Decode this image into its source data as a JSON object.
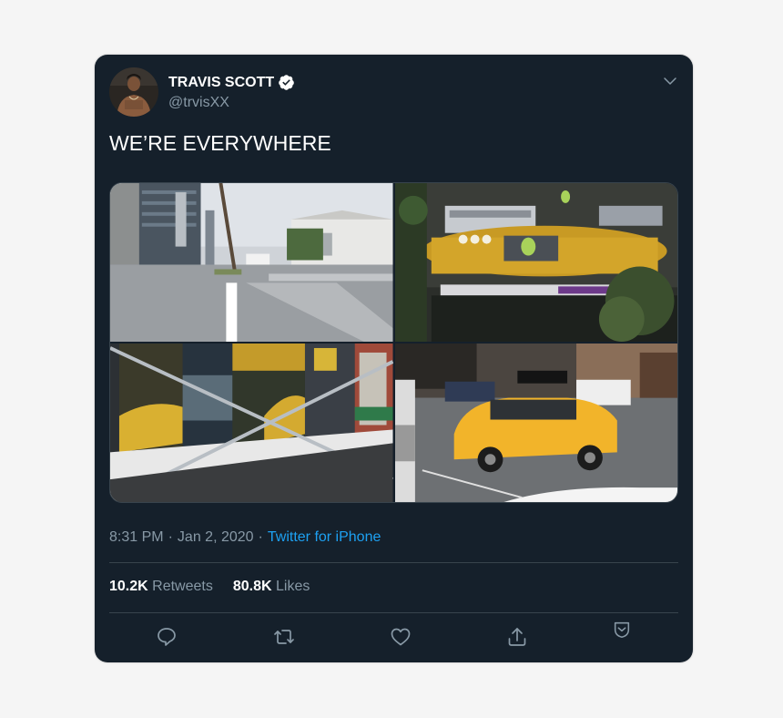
{
  "author": {
    "display_name": "TRAVIS SCOTT",
    "handle": "@trvisXX",
    "verified": true
  },
  "tweet": {
    "text": "WE’RE EVERYWHERE",
    "time": "8:31 PM",
    "date": "Jan 2, 2020",
    "separator": "·",
    "source": "Twitter for iPhone"
  },
  "media": {
    "photos": [
      {
        "subject": "street-intersection"
      },
      {
        "subject": "billboard-taxi-art"
      },
      {
        "subject": "construction-wall-posters"
      },
      {
        "subject": "yellow-taxi-street"
      }
    ]
  },
  "stats": {
    "retweets_count": "10.2K",
    "retweets_label": "Retweets",
    "likes_count": "80.8K",
    "likes_label": "Likes"
  },
  "icons": {
    "reply": "reply-icon",
    "retweet": "retweet-icon",
    "like": "heart-icon",
    "share": "share-icon",
    "bookmark": "bookmark-icon",
    "caret": "chevron-down-icon",
    "verified": "verified-badge-icon"
  },
  "colors": {
    "card_background": "#15202b",
    "page_background": "#f5f5f5",
    "text_primary": "#ffffff",
    "text_secondary": "#8899a6",
    "accent": "#1da1f2",
    "border": "#38444d"
  }
}
